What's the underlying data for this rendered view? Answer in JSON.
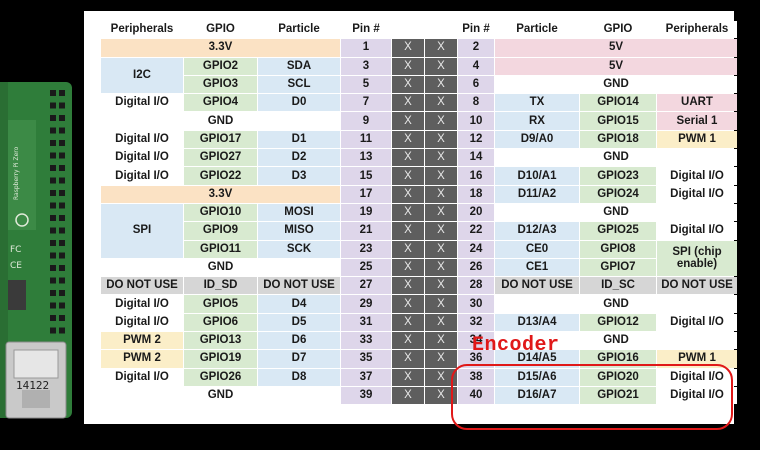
{
  "headers": [
    "Peripherals",
    "GPIO",
    "Particle",
    "Pin #",
    "",
    "",
    "Pin #",
    "Particle",
    "GPIO",
    "Peripherals"
  ],
  "cross": "X",
  "rows": [
    [
      {
        "t": "3.3V",
        "s": 3,
        "c": "pw"
      },
      "1",
      "2",
      {
        "t": "5V",
        "s": 3,
        "c": "pk"
      }
    ],
    [
      {
        "t": "I2C",
        "r": 2,
        "c": "bl"
      },
      {
        "t": "GPIO2",
        "c": "gr"
      },
      {
        "t": "SDA",
        "c": "bl"
      },
      "3",
      "4",
      {
        "t": "5V",
        "s": 3,
        "c": "pk"
      }
    ],
    [
      {
        "t": "GPIO3",
        "c": "gr"
      },
      {
        "t": "SCL",
        "c": "bl"
      },
      "5",
      "6",
      {
        "t": "GND",
        "s": 3,
        "c": "wh"
      }
    ],
    [
      {
        "t": "Digital I/O",
        "c": "wh"
      },
      {
        "t": "GPIO4",
        "c": "gr"
      },
      {
        "t": "D0",
        "c": "bl"
      },
      "7",
      "8",
      {
        "t": "TX",
        "c": "bl"
      },
      {
        "t": "GPIO14",
        "c": "gr"
      },
      {
        "t": "UART",
        "c": "pk"
      }
    ],
    [
      {
        "t": "GND",
        "s": 3,
        "c": "wh"
      },
      "9",
      "10",
      {
        "t": "RX",
        "c": "bl"
      },
      {
        "t": "GPIO15",
        "c": "gr"
      },
      {
        "t": "Serial 1",
        "c": "pk"
      }
    ],
    [
      {
        "t": "Digital I/O",
        "c": "wh"
      },
      {
        "t": "GPIO17",
        "c": "gr"
      },
      {
        "t": "D1",
        "c": "bl"
      },
      "11",
      "12",
      {
        "t": "D9/A0",
        "c": "bl"
      },
      {
        "t": "GPIO18",
        "c": "gr"
      },
      {
        "t": "PWM 1",
        "c": "yl"
      }
    ],
    [
      {
        "t": "Digital I/O",
        "c": "wh"
      },
      {
        "t": "GPIO27",
        "c": "gr"
      },
      {
        "t": "D2",
        "c": "bl"
      },
      "13",
      "14",
      {
        "t": "GND",
        "s": 3,
        "c": "wh"
      }
    ],
    [
      {
        "t": "Digital I/O",
        "c": "wh"
      },
      {
        "t": "GPIO22",
        "c": "gr"
      },
      {
        "t": "D3",
        "c": "bl"
      },
      "15",
      "16",
      {
        "t": "D10/A1",
        "c": "bl"
      },
      {
        "t": "GPIO23",
        "c": "gr"
      },
      {
        "t": "Digital I/O",
        "c": "wh"
      }
    ],
    [
      {
        "t": "3.3V",
        "s": 3,
        "c": "pw"
      },
      "17",
      "18",
      {
        "t": "D11/A2",
        "c": "bl"
      },
      {
        "t": "GPIO24",
        "c": "gr"
      },
      {
        "t": "Digital I/O",
        "c": "wh"
      }
    ],
    [
      {
        "t": "SPI",
        "r": 3,
        "c": "bl"
      },
      {
        "t": "GPIO10",
        "c": "gr"
      },
      {
        "t": "MOSI",
        "c": "bl"
      },
      "19",
      "20",
      {
        "t": "GND",
        "s": 3,
        "c": "wh"
      }
    ],
    [
      {
        "t": "GPIO9",
        "c": "gr"
      },
      {
        "t": "MISO",
        "c": "bl"
      },
      "21",
      "22",
      {
        "t": "D12/A3",
        "c": "bl"
      },
      {
        "t": "GPIO25",
        "c": "gr"
      },
      {
        "t": "Digital I/O",
        "c": "wh"
      }
    ],
    [
      {
        "t": "GPIO11",
        "c": "gr"
      },
      {
        "t": "SCK",
        "c": "bl"
      },
      "23",
      "24",
      {
        "t": "CE0",
        "c": "bl"
      },
      {
        "t": "GPIO8",
        "c": "gr"
      },
      {
        "t": "SPI\n(chip enable)",
        "r": 2,
        "c": "gr"
      }
    ],
    [
      {
        "t": "GND",
        "s": 3,
        "c": "wh"
      },
      "25",
      "26",
      {
        "t": "CE1",
        "c": "bl"
      },
      {
        "t": "GPIO7",
        "c": "gr"
      }
    ],
    [
      {
        "t": "DO NOT USE",
        "c": "fr"
      },
      {
        "t": "ID_SD",
        "c": "fr"
      },
      {
        "t": "DO NOT USE",
        "c": "fr"
      },
      "27",
      "28",
      {
        "t": "DO NOT USE",
        "c": "fr"
      },
      {
        "t": "ID_SC",
        "c": "fr"
      },
      {
        "t": "DO NOT USE",
        "c": "fr"
      }
    ],
    [
      {
        "t": "Digital I/O",
        "c": "wh"
      },
      {
        "t": "GPIO5",
        "c": "gr"
      },
      {
        "t": "D4",
        "c": "bl"
      },
      "29",
      "30",
      {
        "t": "GND",
        "s": 3,
        "c": "wh"
      }
    ],
    [
      {
        "t": "Digital I/O",
        "c": "wh"
      },
      {
        "t": "GPIO6",
        "c": "gr"
      },
      {
        "t": "D5",
        "c": "bl"
      },
      "31",
      "32",
      {
        "t": "D13/A4",
        "c": "bl"
      },
      {
        "t": "GPIO12",
        "c": "gr"
      },
      {
        "t": "Digital I/O",
        "c": "wh"
      }
    ],
    [
      {
        "t": "PWM 2",
        "c": "yl"
      },
      {
        "t": "GPIO13",
        "c": "gr"
      },
      {
        "t": "D6",
        "c": "bl"
      },
      "33",
      "34",
      {
        "t": "GND",
        "s": 3,
        "c": "wh"
      }
    ],
    [
      {
        "t": "PWM 2",
        "c": "yl"
      },
      {
        "t": "GPIO19",
        "c": "gr"
      },
      {
        "t": "D7",
        "c": "bl"
      },
      "35",
      "36",
      {
        "t": "D14/A5",
        "c": "bl"
      },
      {
        "t": "GPIO16",
        "c": "gr"
      },
      {
        "t": "PWM 1",
        "c": "yl"
      }
    ],
    [
      {
        "t": "Digital I/O",
        "c": "wh"
      },
      {
        "t": "GPIO26",
        "c": "gr"
      },
      {
        "t": "D8",
        "c": "bl"
      },
      "37",
      "38",
      {
        "t": "D15/A6",
        "c": "bl"
      },
      {
        "t": "GPIO20",
        "c": "gr"
      },
      {
        "t": "Digital I/O",
        "c": "wh"
      }
    ],
    [
      {
        "t": "GND",
        "s": 3,
        "c": "wh"
      },
      "39",
      "40",
      {
        "t": "D16/A7",
        "c": "bl"
      },
      {
        "t": "GPIO21",
        "c": "gr"
      },
      {
        "t": "Digital I/O",
        "c": "wh"
      }
    ]
  ],
  "annotation": {
    "label": "Encoder",
    "color": "#e01818"
  },
  "board": {
    "model_text": "14122"
  },
  "colors": {
    "power": "#fbe2c4",
    "gpio": "#d8ead0",
    "particle": "#d9e8f4",
    "five_volt": "#f3d7df",
    "pin": "#ded6ea",
    "reserved": "#d6d6d6",
    "pwm": "#fbeec8",
    "cross": "#5e5e5e"
  }
}
